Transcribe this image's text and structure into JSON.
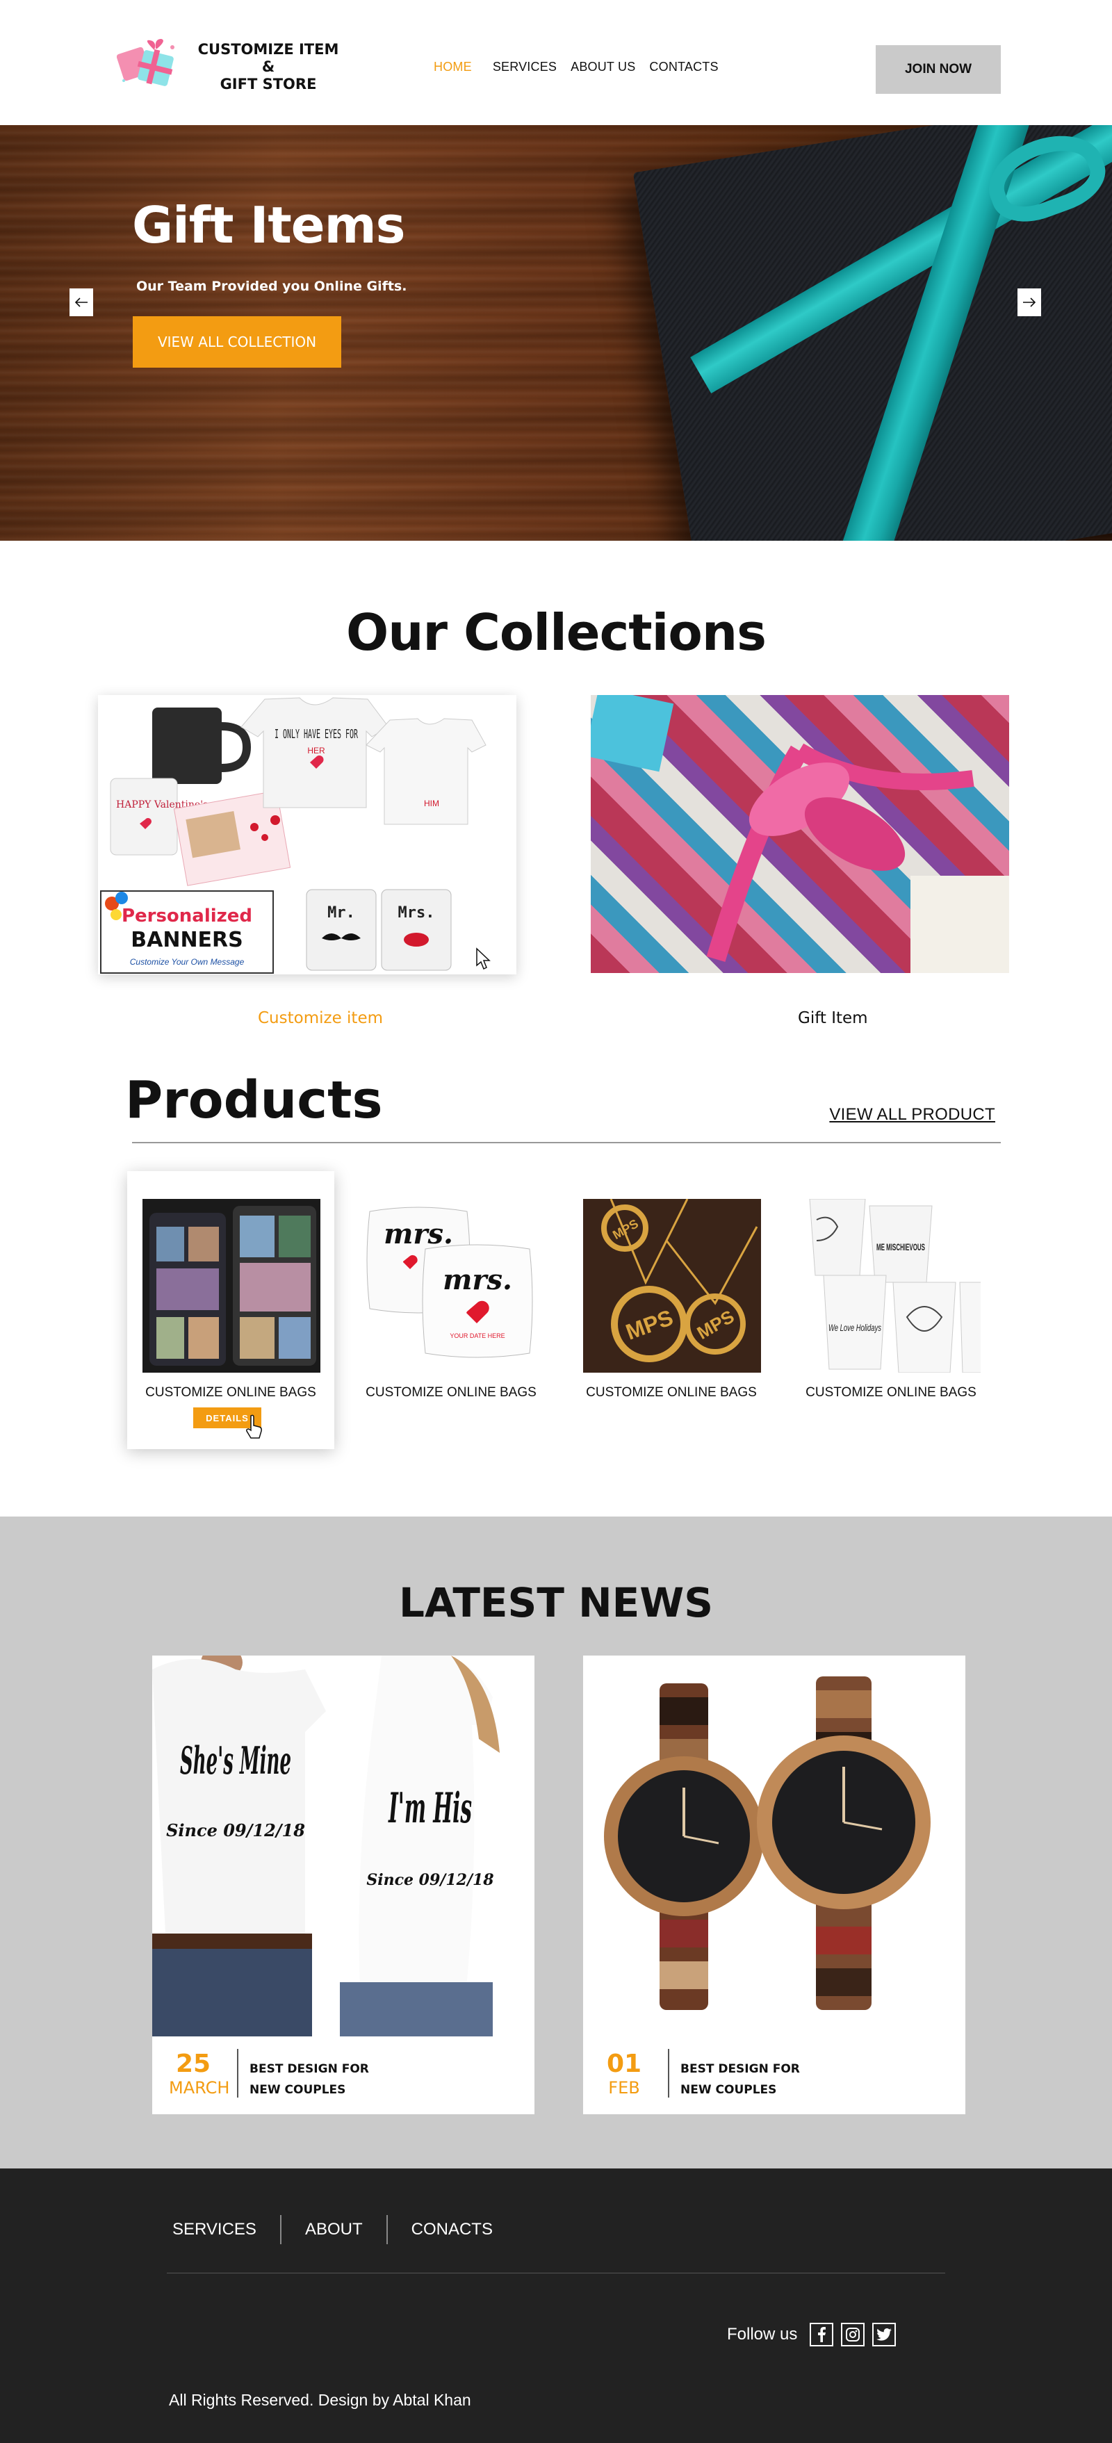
{
  "header": {
    "logo_line1": "CUSTOMIZE ITEM &",
    "logo_line2": "GIFT STORE",
    "nav": [
      "HOME",
      "SERVICES",
      "ABOUT US",
      "CONTACTS"
    ],
    "join_label": "JOIN NOW"
  },
  "hero": {
    "title": "Gift Items",
    "subtitle": "Our Team Provided you Online Gifts.",
    "cta_label": "VIEW ALL COLLECTION",
    "prev_icon": "arrow-left-icon",
    "next_icon": "arrow-right-icon"
  },
  "collections": {
    "title": "Our Collections",
    "items": [
      {
        "label": "Customize item",
        "color": "#f39c12"
      },
      {
        "label": "Gift Item",
        "color": "#111111"
      }
    ],
    "mug_text": "HAPPY Valentine's",
    "tee_text": "I ONLY HAVE EYES FOR",
    "tee_her": "HER",
    "tee_him": "HIM",
    "banner_text": "Personalized",
    "banner_text2": "BANNERS",
    "banner_sub": "Customize Your Own Message",
    "mug_mr": "Mr.",
    "mug_mrs": "Mrs."
  },
  "products": {
    "title": "Products",
    "view_all": "VIEW ALL PRODUCT",
    "items": [
      {
        "name": "CUSTOMIZE ONLINE BAGS",
        "details": "DETAILS"
      },
      {
        "name": "CUSTOMIZE ONLINE BAGS"
      },
      {
        "name": "CUSTOMIZE ONLINE BAGS"
      },
      {
        "name": "CUSTOMIZE ONLINE BAGS"
      }
    ],
    "pillow_text1": "mrs.",
    "pillow_text2": "mrs.",
    "pillow_sub": "YOUR DATE HERE",
    "pendant_text": "MPS",
    "cup_texts": [
      "ME MISCHIEVOUS",
      "We Love Holidays"
    ]
  },
  "news": {
    "title": "LATEST NEWS",
    "cards": [
      {
        "day": "25",
        "month": "MARCH",
        "line1": "BEST DESIGN FOR",
        "line2": "NEW COUPLES",
        "shirt1": "She's Mine",
        "shirt1_sub": "Since 09/12/18",
        "shirt2": "I'm His",
        "shirt2_sub": "Since 09/12/18"
      },
      {
        "day": "01",
        "month": "FEB",
        "line1": "BEST DESIGN FOR",
        "line2": "NEW COUPLES"
      }
    ]
  },
  "footer": {
    "nav": [
      "SERVICES",
      "ABOUT",
      "CONACTS"
    ],
    "follow": "Follow us",
    "social": [
      "facebook-icon",
      "instagram-icon",
      "twitter-icon"
    ],
    "copyright": "All Rights Reserved. Design by Abtal Khan"
  },
  "colors": {
    "accent": "#f39c12",
    "news_bg": "#cacaca",
    "footer_bg": "#222222"
  }
}
